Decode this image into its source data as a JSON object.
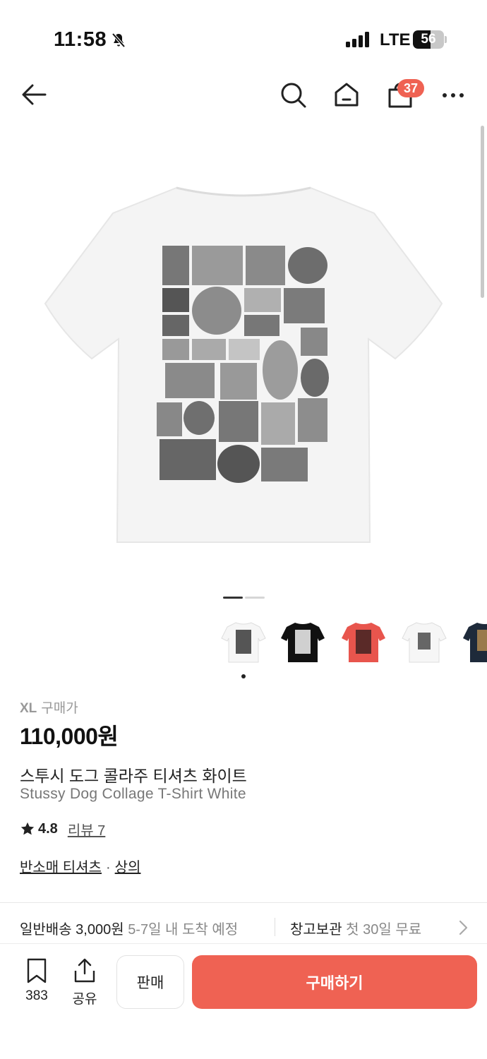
{
  "status_bar": {
    "time": "11:58",
    "network": "LTE",
    "battery": "56",
    "battery_level": 0.56
  },
  "nav": {
    "cart_count": "37",
    "icons": [
      "back-arrow-icon",
      "search-icon",
      "home-icon",
      "shopping-bag-icon",
      "more-icon"
    ]
  },
  "gallery": {
    "page_count": 2,
    "current_page": 1,
    "thumbnail_colors": [
      "#ffffff",
      "#111111",
      "#e8554d",
      "#ffffff",
      "#1e2a3a"
    ]
  },
  "product": {
    "size": "XL",
    "price_label": "구매가",
    "price": "110,000원",
    "name_ko": "스투시 도그 콜라주 티셔츠 화이트",
    "name_en": "Stussy Dog Collage T-Shirt White",
    "rating": "4.8",
    "reviews": "리뷰 7",
    "category_sub": "반소매 티셔츠",
    "category_separator": "·",
    "category_main": "상의"
  },
  "shipping": {
    "type": "일반배송",
    "fee": "3,000원",
    "eta": "5-7일 내 도착 예정",
    "storage_label": "창고보관",
    "storage_desc": "첫 30일 무료"
  },
  "bottom_bar": {
    "bookmark_count": "383",
    "share_label": "공유",
    "sell_label": "판매",
    "buy_label": "구매하기"
  },
  "colors": {
    "accent": "#ef6253"
  }
}
